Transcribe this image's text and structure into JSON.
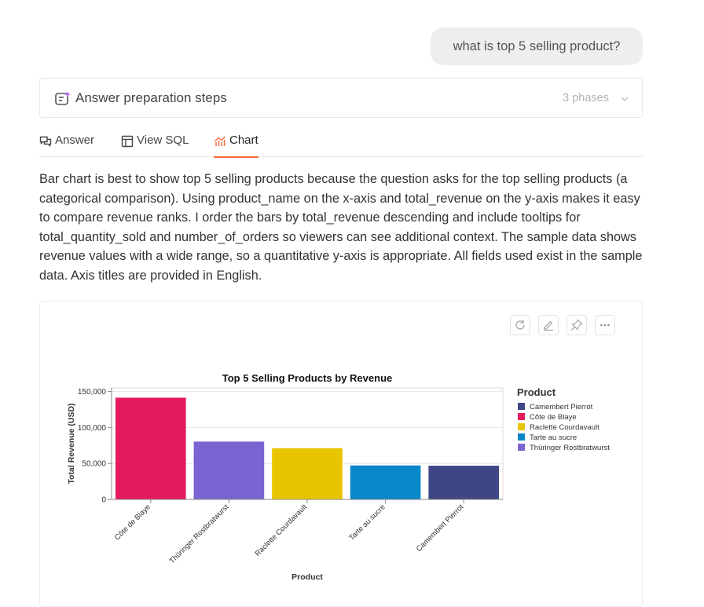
{
  "user_message": "what is top 5 selling product?",
  "prep": {
    "title": "Answer preparation steps",
    "phases": "3 phases"
  },
  "tabs": [
    {
      "label": "Answer",
      "icon": "chat-bubbles-icon",
      "active": false
    },
    {
      "label": "View SQL",
      "icon": "table-icon",
      "active": false
    },
    {
      "label": "Chart",
      "icon": "chart-icon",
      "active": true
    }
  ],
  "answer_text": "Bar chart is best to show top 5 selling products because the question asks for the top selling products (a categorical comparison). Using product_name on the x-axis and total_revenue on the y-axis makes it easy to compare revenue ranks. I order the bars by total_revenue descending and include tooltips for total_quantity_sold and number_of_orders so viewers can see additional context. The sample data shows revenue values with a wide range, so a quantitative y-axis is appropriate. All fields used exist in the sample data. Axis titles are provided in English.",
  "chart_toolbar": [
    "refresh-icon",
    "edit-icon",
    "pin-icon",
    "more-icon"
  ],
  "chart_data": {
    "type": "bar",
    "title": "Top 5 Selling Products by Revenue",
    "xlabel": "Product",
    "ylabel": "Total Revenue (USD)",
    "ylim": [
      0,
      155000
    ],
    "yticks": [
      0,
      50000,
      100000,
      150000
    ],
    "ytick_labels": [
      "0",
      "50,000",
      "100,000",
      "150,000"
    ],
    "grid": true,
    "categories": [
      "Côte de Blaye",
      "Thüringer Rostbratwurst",
      "Raclette Courdavault",
      "Tarte au sucre",
      "Camembert Pierrot"
    ],
    "values": [
      141400,
      80400,
      71200,
      47200,
      46800
    ],
    "colors": [
      "#e31a5b",
      "#7a64d1",
      "#e9c400",
      "#0a87c8",
      "#3f4685"
    ],
    "legend_title": "Product",
    "legend_position": "right",
    "legend": [
      {
        "label": "Camembert Pierrot",
        "color": "#3f4685"
      },
      {
        "label": "Côte de Blaye",
        "color": "#e31a5b"
      },
      {
        "label": "Raclette Courdavault",
        "color": "#e9c400"
      },
      {
        "label": "Tarte au sucre",
        "color": "#0a87c8"
      },
      {
        "label": "Thüringer Rostbratwurst",
        "color": "#7a64d1"
      }
    ]
  }
}
